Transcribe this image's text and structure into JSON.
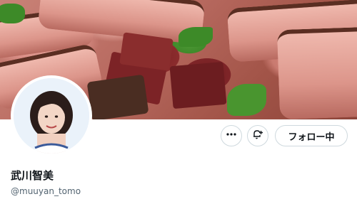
{
  "profile": {
    "display_name": "武川智美",
    "handle": "@muuyan_tomo",
    "banner_description": "",
    "follow_button_label": "フォロー中"
  },
  "icons": {
    "more": "more-horizontal-icon",
    "notify": "bell-plus-icon"
  },
  "colors": {
    "text_primary": "#0f1419",
    "text_secondary": "#536471",
    "border": "#cfd9de"
  }
}
